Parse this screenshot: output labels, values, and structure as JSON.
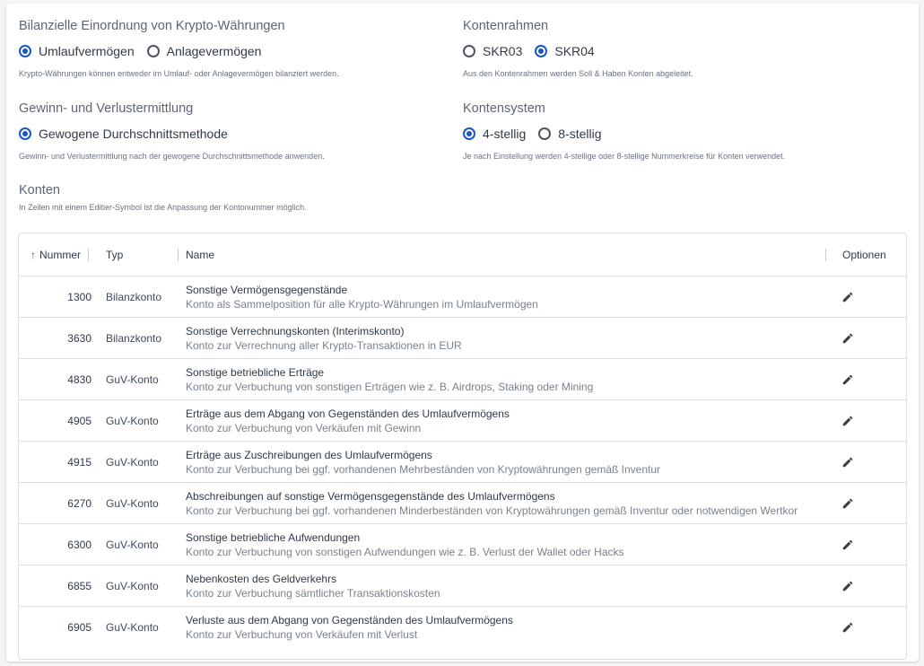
{
  "bilanz": {
    "title": "Bilanzielle Einordnung von Krypto-Währungen",
    "options": [
      "Umlaufvermögen",
      "Anlagevermögen"
    ],
    "selected": 0,
    "hint": "Krypto-Währungen können entweder im Umlauf- oder Anlagevermögen bilanziert werden."
  },
  "kontenrahmen": {
    "title": "Kontenrahmen",
    "options": [
      "SKR03",
      "SKR04"
    ],
    "selected": 1,
    "hint": "Aus den Kontenrahmen werden Soll & Haben Konten abgeleitet."
  },
  "guv": {
    "title": "Gewinn- und Verlustermittlung",
    "options": [
      "Gewogene Durchschnittsmethode"
    ],
    "selected": 0,
    "hint": "Gewinn- und Verlustermittlung nach der gewogene Durchschnittsmethode anwenden."
  },
  "kontensystem": {
    "title": "Kontensystem",
    "options": [
      "4-stellig",
      "8-stellig"
    ],
    "selected": 0,
    "hint": "Je nach Einstellung werden 4-stellige oder 8-stellige Nummerkreise für Konten verwendet."
  },
  "konten": {
    "title": "Konten",
    "hint": "In Zeilen mit einem Editier-Symbol ist die Anpassung der Kontonummer möglich."
  },
  "table": {
    "headers": {
      "nummer": "Nummer",
      "typ": "Typ",
      "name": "Name",
      "optionen": "Optionen"
    },
    "sort_icon": "arrow-up-icon",
    "rows": [
      {
        "nummer": "1300",
        "typ": "Bilanzkonto",
        "name": "Sonstige Vermögensgegenstände",
        "desc": "Konto als Sammelposition für alle Krypto-Währungen im Umlaufvermögen"
      },
      {
        "nummer": "3630",
        "typ": "Bilanzkonto",
        "name": "Sonstige Verrechnungskonten (Interimskonto)",
        "desc": "Konto zur Verrechnung aller Krypto-Transaktionen in EUR"
      },
      {
        "nummer": "4830",
        "typ": "GuV-Konto",
        "name": "Sonstige betriebliche Erträge",
        "desc": "Konto zur Verbuchung von sonstigen Erträgen wie z. B. Airdrops, Staking oder Mining"
      },
      {
        "nummer": "4905",
        "typ": "GuV-Konto",
        "name": "Erträge aus dem Abgang von Gegenständen des Umlaufvermögens",
        "desc": "Konto zur Verbuchung von Verkäufen mit Gewinn"
      },
      {
        "nummer": "4915",
        "typ": "GuV-Konto",
        "name": "Erträge aus Zuschreibungen des Umlaufvermögens",
        "desc": "Konto zur Verbuchung bei ggf. vorhandenen Mehrbeständen von Kryptowährungen gemäß Inventur"
      },
      {
        "nummer": "6270",
        "typ": "GuV-Konto",
        "name": "Abschreibungen auf sonstige Vermögensgegenstände des Umlaufvermögens",
        "desc": "Konto zur Verbuchung bei ggf. vorhandenen Minderbeständen von Kryptowährungen gemäß Inventur oder notwendigen Wertkor"
      },
      {
        "nummer": "6300",
        "typ": "GuV-Konto",
        "name": "Sonstige betriebliche Aufwendungen",
        "desc": "Konto zur Verbuchung von sonstigen Aufwendungen wie z. B. Verlust der Wallet oder Hacks"
      },
      {
        "nummer": "6855",
        "typ": "GuV-Konto",
        "name": "Nebenkosten des Geldverkehrs",
        "desc": "Konto zur Verbuchung sämtlicher Transaktionskosten"
      },
      {
        "nummer": "6905",
        "typ": "GuV-Konto",
        "name": "Verluste aus dem Abgang von Gegenständen des Umlaufvermögens",
        "desc": "Konto zur Verbuchung von Verkäufen mit Verlust"
      }
    ],
    "edit_icon": "pencil-icon"
  },
  "colors": {
    "accent": "#1a56c8",
    "border": "#dcdfe4",
    "text": "#2f3a48",
    "muted": "#7a828d"
  }
}
